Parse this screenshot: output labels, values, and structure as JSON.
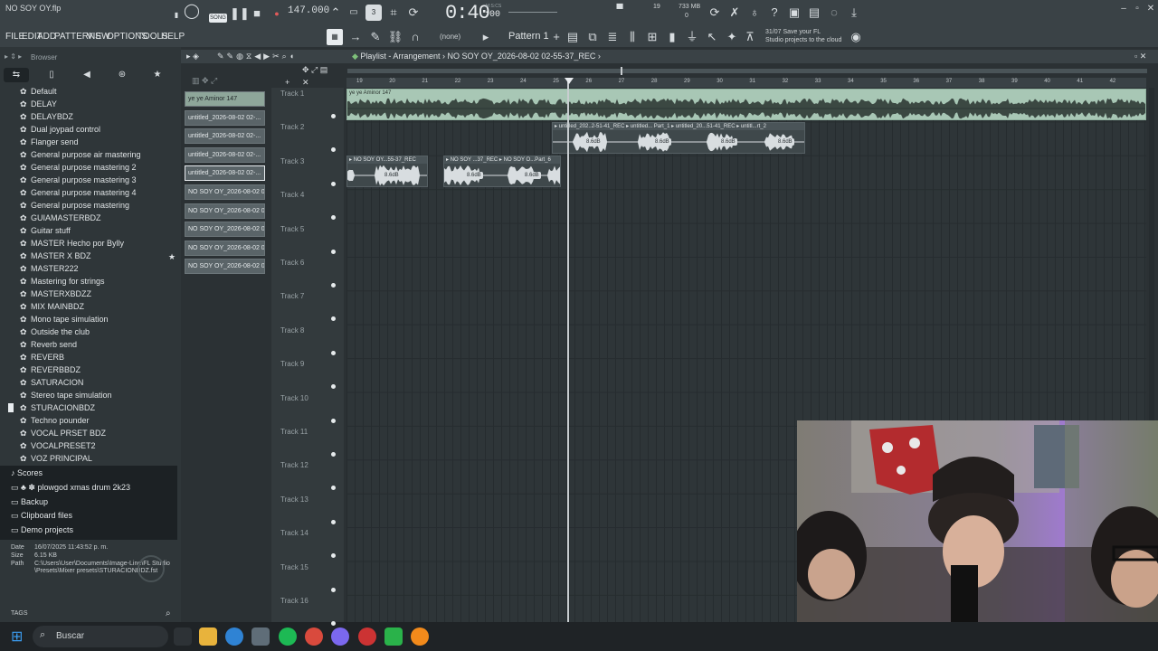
{
  "window": {
    "title": "NO SOY OY.flp"
  },
  "transport": {
    "tempo": "147.000",
    "time": "0:40",
    "time_ms": ":00",
    "time_units": "M:S:CS",
    "pattern_mode_label": "SONG",
    "cpu": "19",
    "memory": "733 MB",
    "voices": "0"
  },
  "menu": [
    "FILE",
    "EDIT",
    "ADD",
    "PATTERNS",
    "VIEW",
    "OPTIONS",
    "TOOLS",
    "HELP"
  ],
  "toolbar": {
    "snap": "(none)",
    "pattern": "Pattern 1",
    "hint_date": "31/07",
    "hint_line1": "Save your FL",
    "hint_line2": "Studio projects to the cloud"
  },
  "browser": {
    "title": "Browser",
    "presets": [
      "Default",
      "DELAY",
      "DELAYBDZ",
      "Dual joypad control",
      "Flanger send",
      "General purpose air mastering",
      "General purpose mastering 2",
      "General purpose mastering 3",
      "General purpose mastering 4",
      "General purpose mastering",
      "GUIAMASTERBDZ",
      "Guitar stuff",
      "MASTER Hecho por Bylly",
      "MASTER X BDZ",
      "MASTER222",
      "Mastering for strings",
      "MASTERXBDZZ",
      "MIX MAINBDZ",
      "Mono tape simulation",
      "Outside the club",
      "Reverb send",
      "REVERB",
      "REVERBBDZ",
      "SATURACION",
      "Stereo tape simulation",
      "STURACIONBDZ",
      "Techno pounder",
      "VOCAL PRSET BDZ",
      "VOCALPRESET2",
      "VOZ PRINCIPAL"
    ],
    "folders": [
      "Scores",
      "plowgod xmas drum 2k23",
      "Backup",
      "Clipboard files",
      "Demo projects"
    ],
    "info": {
      "date_label": "Date",
      "date": "16/07/2025 11:43:52 p. m.",
      "size_label": "Size",
      "size": "6.15 KB",
      "path_label": "Path",
      "path": "C:\\Users\\User\\Documents\\Image-Line\\FL Studio\\Presets\\Mixer presets\\STURACIONBDZ.fst"
    },
    "tags_label": "TAGS"
  },
  "clips": [
    "ye ye Aminor 147",
    "untitled_2026-08-02 02-...",
    "untitled_2026-08-02 02-...",
    "untitled_2026-08-02 02-...",
    "untitled_2026-08-02 02-...",
    "NO SOY OY_2026-08-02 0...",
    "NO SOY OY_2026-08-02 0...",
    "NO SOY OY_2026-08-02 0...",
    "NO SOY OY_2026-08-02 0...",
    "NO SOY OY_2026-08-02 0..."
  ],
  "playlist": {
    "title": "Playlist - Arrangement",
    "current_clip": "NO SOY OY_2026-08-02 02-55-37_REC",
    "bars": [
      "19",
      "20",
      "21",
      "22",
      "23",
      "24",
      "25",
      "26",
      "27",
      "28",
      "29",
      "30",
      "31",
      "32",
      "33",
      "34",
      "35",
      "36",
      "37",
      "38",
      "39",
      "40",
      "41",
      "42"
    ],
    "tracks": [
      "Track 1",
      "Track 2",
      "Track 3",
      "Track 4",
      "Track 5",
      "Track 6",
      "Track 7",
      "Track 8",
      "Track 9",
      "Track 10",
      "Track 11",
      "Track 12",
      "Track 13",
      "Track 14",
      "Track 15",
      "Track 16"
    ],
    "track1_clip": "ye ye Aminor 147",
    "track2_clips": [
      "untitled_202..2-51-41_REC",
      "untitled... Part_1",
      "untitled_20...51-41_REC",
      "untitl...rt_2"
    ],
    "track3_clips": [
      "NO SOY OY...55-37_REC",
      "NO SOY ...37_REC",
      "NO SOY O...Part_6"
    ],
    "gain": "8.6dB"
  },
  "taskbar": {
    "search": "Buscar"
  }
}
